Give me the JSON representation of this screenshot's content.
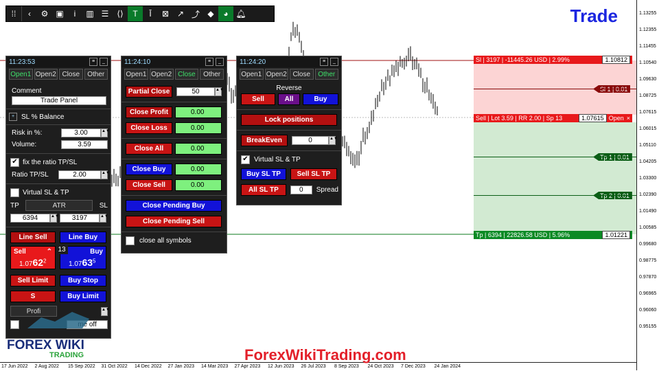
{
  "toolbar": {
    "icons": [
      "grip-icon",
      "back-icon",
      "gear-icon",
      "camera-icon",
      "info-icon",
      "bars-icon",
      "list-icon",
      "code-icon",
      "t-icon",
      "cursor-icon",
      "crossed-icon",
      "trend-icon",
      "trend2-icon",
      "shield-icon",
      "pie-icon",
      "bell-icon"
    ]
  },
  "title": "Trade",
  "price_axis": [
    "1.13255",
    "1.12355",
    "1.11455",
    "1.10540",
    "1.09630",
    "1.08725",
    "1.07615",
    "1.06015",
    "1.05110",
    "1.04205",
    "1.03300",
    "1.02390",
    "1.01490",
    "1.00585",
    "0.99680",
    "0.98775",
    "0.97870",
    "0.96965",
    "0.96060",
    "0.95155"
  ],
  "time_axis": [
    "17 Jun 2022",
    "2 Aug 2022",
    "15 Sep 2022",
    "31 Oct 2022",
    "14 Dec 2022",
    "27 Jan 2023",
    "14 Mar 2023",
    "27 Apr 2023",
    "12 Jun 2023",
    "26 Jul 2023",
    "8 Sep 2023",
    "24 Oct 2023",
    "7 Dec 2023",
    "24 Jan 2024"
  ],
  "sl_line": {
    "text": "Sl | 3197 | -11445.26 USD | 2.99%",
    "price": "1.10812"
  },
  "sl1_tag": "Sl 1 | 0.01",
  "sell_line": {
    "text": "Sell | Lot 3.59 | RR 2.00 | Sp 13",
    "price": "1.07615",
    "status": "Open",
    "close": "×"
  },
  "tp1_tag": "Tp 1 | 0.01",
  "tp2_tag": "Tp 2 | 0.01",
  "tp_line": {
    "text": "Tp | 6394 | 22826.58 USD | 5.96%",
    "price": "1.01221"
  },
  "panel1": {
    "time": "11:23:53",
    "tabs": [
      "Open1",
      "Open2",
      "Close",
      "Other"
    ],
    "comment_label": "Comment",
    "comment_value": "Trade Panel",
    "sl_mode_plus": "+",
    "sl_mode": "SL % Balance",
    "risk_label": "Risk in %:",
    "risk_value": "3.00",
    "volume_label": "Volume:",
    "volume_value": "3.59",
    "fix_ratio_label": "fix the ratio TP/SL",
    "ratio_label": "Ratio TP/SL",
    "ratio_value": "2.00",
    "virtual_label": "Virtual SL & TP",
    "tp_label": "TP",
    "atr_label": "ATR",
    "sl_label": "SL",
    "tp_value": "6394",
    "sl_value": "3197",
    "line_sell": "Line Sell",
    "line_buy": "Line Buy",
    "sell_label": "Sell",
    "buy_label": "Buy",
    "spread": "13",
    "sell_price_prefix": "1.07",
    "sell_price_big": "62",
    "sell_price_small": "2",
    "buy_price_prefix": "1.07",
    "buy_price_big": "63",
    "buy_price_small": "5",
    "sell_limit": "Sell Limit",
    "buy_stop": "Buy Stop",
    "sell_stop_partial": "S",
    "buy_limit": "Buy Limit",
    "profit_partial": "Profi",
    "time_off_partial": "me off"
  },
  "panel2": {
    "time": "11:24:10",
    "tabs": [
      "Open1",
      "Open2",
      "Close",
      "Other"
    ],
    "partial_close": "Partial Close",
    "partial_value": "50",
    "close_profit": "Close Profit",
    "close_profit_val": "0.00",
    "close_loss": "Close Loss",
    "close_loss_val": "0.00",
    "close_all": "Close All",
    "close_all_val": "0.00",
    "close_buy": "Close Buy",
    "close_buy_val": "0.00",
    "close_sell": "Close Sell",
    "close_sell_val": "0.00",
    "close_pending_buy": "Close Pending Buy",
    "close_pending_sell": "Close Pending Sell",
    "close_all_symbols": "close all symbols"
  },
  "panel3": {
    "time": "11:24:20",
    "tabs": [
      "Open1",
      "Open2",
      "Close",
      "Other"
    ],
    "reverse_label": "Reverse",
    "sell": "Sell",
    "all": "All",
    "buy": "Buy",
    "lock_positions": "Lock positions",
    "breakeven": "BreakEven",
    "breakeven_value": "0",
    "virtual_label": "Virtual SL & TP",
    "buy_sl_tp": "Buy SL TP",
    "sell_sl_tp": "Sell SL TP",
    "all_sl_tp": "All SL TP",
    "spread_value": "0",
    "spread_label": "Spread"
  },
  "watermark_url": "ForexWikiTrading.com",
  "logo_text": "FOREX WIKI",
  "logo_sub": "TRADING",
  "colors": {
    "sl_red": "#e8191b",
    "tp_green": "#0b8a24",
    "accent_blue": "#1b26e0"
  }
}
